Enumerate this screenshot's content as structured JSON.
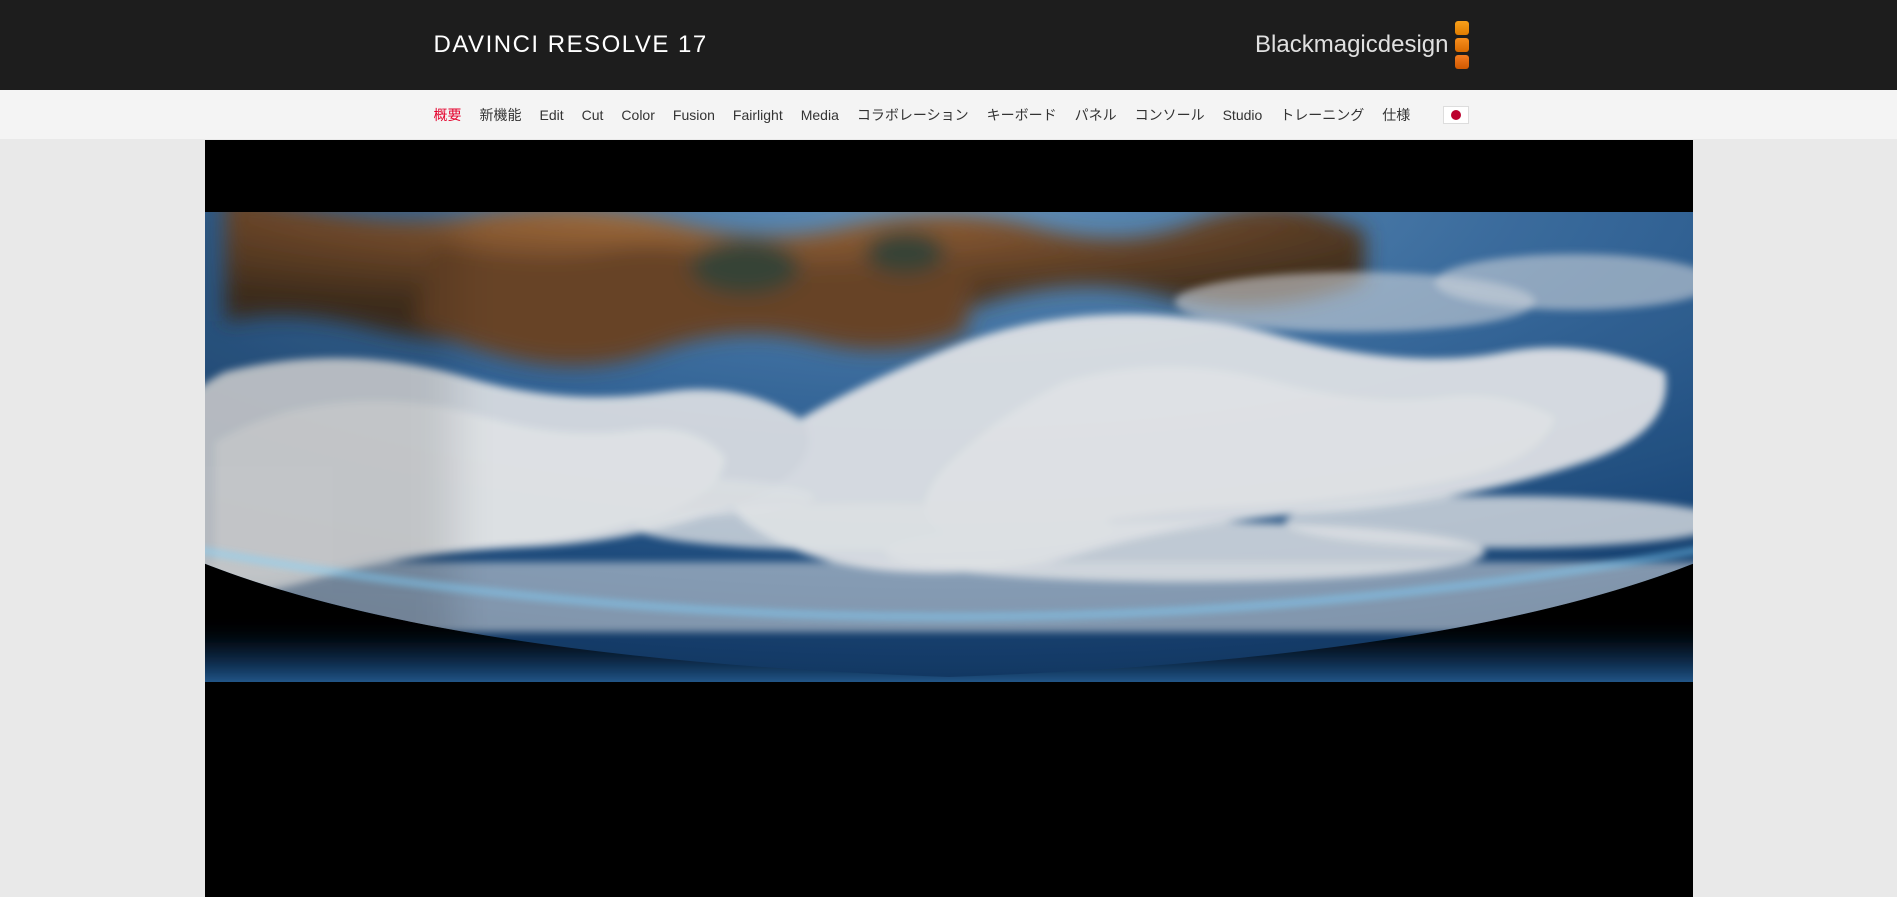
{
  "header": {
    "product_title": "DAVINCI RESOLVE 17",
    "brand_text_a": "Blackmagic",
    "brand_text_b": "design"
  },
  "nav": {
    "items": [
      {
        "label": "概要",
        "active": true
      },
      {
        "label": "新機能",
        "active": false
      },
      {
        "label": "Edit",
        "active": false
      },
      {
        "label": "Cut",
        "active": false
      },
      {
        "label": "Color",
        "active": false
      },
      {
        "label": "Fusion",
        "active": false
      },
      {
        "label": "Fairlight",
        "active": false
      },
      {
        "label": "Media",
        "active": false
      },
      {
        "label": "コラボレーション",
        "active": false
      },
      {
        "label": "キーボード",
        "active": false
      },
      {
        "label": "パネル",
        "active": false
      },
      {
        "label": "コンソール",
        "active": false
      },
      {
        "label": "Studio",
        "active": false
      },
      {
        "label": "トレーニング",
        "active": false
      },
      {
        "label": "仕様",
        "active": false
      }
    ],
    "language": "ja"
  }
}
